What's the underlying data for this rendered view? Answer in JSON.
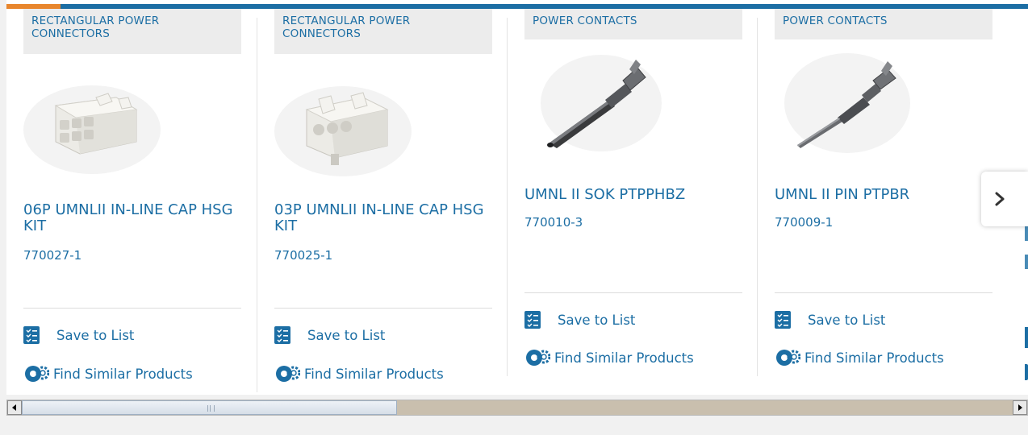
{
  "products": [
    {
      "category": "RECTANGULAR POWER CONNECTORS",
      "title": "06P UMNLII IN-LINE CAP HSG KIT",
      "part_number": "770027-1",
      "image": "6-position-connector-image",
      "save_label": "Save to List",
      "find_label": "Find Similar Products"
    },
    {
      "category": "RECTANGULAR POWER CONNECTORS",
      "title": "03P UMNLII IN-LINE CAP HSG KIT",
      "part_number": "770025-1",
      "image": "3-position-connector-image",
      "save_label": "Save to List",
      "find_label": "Find Similar Products"
    },
    {
      "category": "POWER CONTACTS",
      "title": "UMNL II SOK PTPPHBZ",
      "part_number": "770010-3",
      "image": "socket-contact-image",
      "save_label": "Save to List",
      "find_label": "Find Similar Products"
    },
    {
      "category": "POWER CONTACTS",
      "title": "UMNL II PIN PTPBR",
      "part_number": "770009-1",
      "image": "pin-contact-image",
      "save_label": "Save to List",
      "find_label": "Find Similar Products"
    }
  ],
  "icons": {
    "save": "checklist-icon",
    "find": "gears-icon",
    "next": "chevron-right-icon"
  },
  "colors": {
    "accent_blue": "#1c6ea4",
    "accent_orange": "#e8862d",
    "category_bg": "#ececec"
  },
  "scrollbar": {
    "position_fraction": 0.0
  }
}
